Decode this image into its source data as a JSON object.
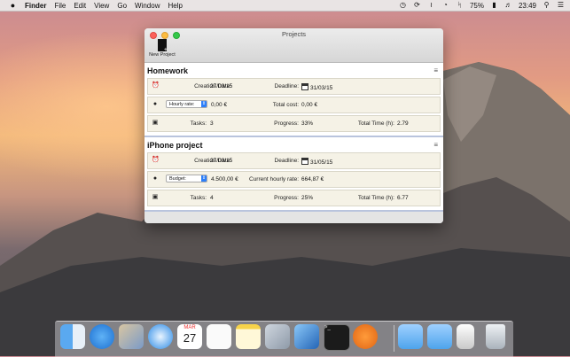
{
  "menubar": {
    "apple": "",
    "app_name": "Finder",
    "items": [
      "File",
      "Edit",
      "View",
      "Go",
      "Window",
      "Help"
    ],
    "status": {
      "battery": "75%",
      "time": "23:49"
    },
    "status_icons": [
      "clock-icon",
      "sync-icon",
      "wifi-icon",
      "time-machine-icon",
      "bluetooth-icon",
      "battery-icon",
      "volume-icon",
      "search-icon",
      "list-icon"
    ]
  },
  "window": {
    "title": "Projects",
    "toolbar": {
      "new_project_label": "New Project"
    }
  },
  "projects": [
    {
      "name": "Homework",
      "creation_label": "Creation Date:",
      "creation_value": "27/03/15",
      "deadline_label": "Deadline:",
      "deadline_value": "31/03/15",
      "rate_option": "Hourly rate:",
      "rate_value": "0,00 €",
      "cost_label": "Total cost:",
      "cost_value": "0,00 €",
      "tasks_label": "Tasks:",
      "tasks_value": "3",
      "progress_label": "Progress:",
      "progress_value": "33%",
      "time_label": "Total Time (h):",
      "time_value": "2.79"
    },
    {
      "name": "iPhone project",
      "creation_label": "Creation Date:",
      "creation_value": "27/03/15",
      "deadline_label": "Deadline:",
      "deadline_value": "31/05/15",
      "rate_option": "Budget:",
      "rate_value": "4.500,00 €",
      "cost_label": "Current hourly rate:",
      "cost_value": "664,87 €",
      "tasks_label": "Tasks:",
      "tasks_value": "4",
      "progress_label": "Progress:",
      "progress_value": "25%",
      "time_label": "Total Time (h):",
      "time_value": "6.77"
    }
  ],
  "dock": {
    "calendar_month": "MAR",
    "calendar_day": "27",
    "apps": [
      "finder-icon",
      "app-store-icon",
      "preview-icon",
      "safari-icon",
      "calendar-icon",
      "reminders-icon",
      "notes-icon",
      "photos-icon",
      "xcode-icon",
      "terminal-icon",
      "ibooks-icon",
      "folder-icon",
      "downloads-folder-icon",
      "archive-icon",
      "trash-icon"
    ]
  },
  "colors": {
    "accent": "#2d7ff9",
    "row_bg": "#f5f2e6",
    "separator": "#b9c4dd"
  }
}
